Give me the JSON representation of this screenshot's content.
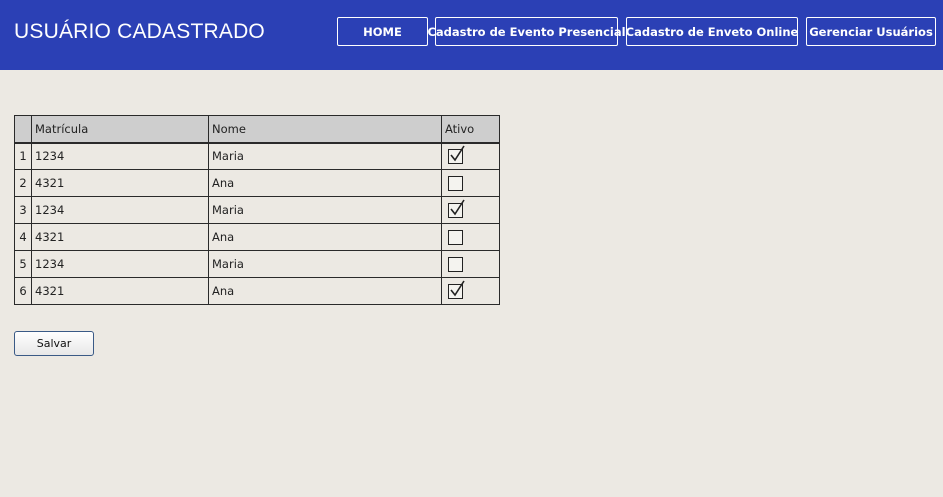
{
  "header": {
    "title": "USUÁRIO CADASTRADO",
    "nav": {
      "home": "HOME",
      "presencial": "Cadastro de Evento Presencial",
      "online": "Cadastro de Enveto Online",
      "usuarios": "Gerenciar Usuários"
    }
  },
  "table": {
    "columns": {
      "matricula": "Matrícula",
      "nome": "Nome",
      "ativo": "Ativo"
    },
    "rows": [
      {
        "index": "1",
        "matricula": "1234",
        "nome": "Maria",
        "ativo": true
      },
      {
        "index": "2",
        "matricula": "4321",
        "nome": "Ana",
        "ativo": false
      },
      {
        "index": "3",
        "matricula": "1234",
        "nome": "Maria",
        "ativo": true
      },
      {
        "index": "4",
        "matricula": "4321",
        "nome": "Ana",
        "ativo": false
      },
      {
        "index": "5",
        "matricula": "1234",
        "nome": "Maria",
        "ativo": false
      },
      {
        "index": "6",
        "matricula": "4321",
        "nome": "Ana",
        "ativo": true
      }
    ]
  },
  "actions": {
    "save_label": "Salvar"
  },
  "colors": {
    "header_bg": "#2B40B5",
    "page_bg": "#ECE9E3",
    "table_header_bg": "#CECECE"
  }
}
